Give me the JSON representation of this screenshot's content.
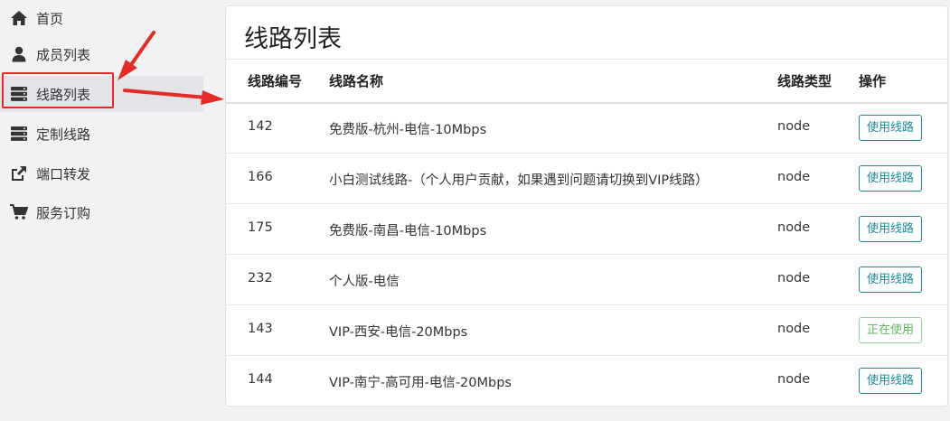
{
  "sidebar": {
    "items": [
      {
        "label": "首页",
        "icon": "home-icon"
      },
      {
        "label": "成员列表",
        "icon": "user-icon"
      },
      {
        "label": "线路列表",
        "icon": "server-icon"
      },
      {
        "label": "定制线路",
        "icon": "server-icon"
      },
      {
        "label": "端口转发",
        "icon": "share-icon"
      },
      {
        "label": "服务订购",
        "icon": "cart-icon"
      }
    ]
  },
  "main": {
    "title": "线路列表",
    "columns": [
      "线路编号",
      "线路名称",
      "线路类型",
      "操作"
    ],
    "rows": [
      {
        "id": "142",
        "name": "免费版-杭州-电信-10Mbps",
        "type": "node",
        "action": "使用线路"
      },
      {
        "id": "166",
        "name": "小白测试线路-（个人用户贡献，如果遇到问题请切换到VIP线路）",
        "type": "node",
        "action": "使用线路"
      },
      {
        "id": "175",
        "name": "免费版-南昌-电信-10Mbps",
        "type": "node",
        "action": "使用线路"
      },
      {
        "id": "232",
        "name": "个人版-电信",
        "type": "node",
        "action": "使用线路"
      },
      {
        "id": "143",
        "name": "VIP-西安-电信-20Mbps",
        "type": "node",
        "action": "正在使用"
      },
      {
        "id": "144",
        "name": "VIP-南宁-高可用-电信-20Mbps",
        "type": "node",
        "action": "使用线路"
      }
    ]
  },
  "colors": {
    "accent": "#1b8a9a",
    "in_use": "#5cb85c",
    "annotation": "#e52b25"
  }
}
